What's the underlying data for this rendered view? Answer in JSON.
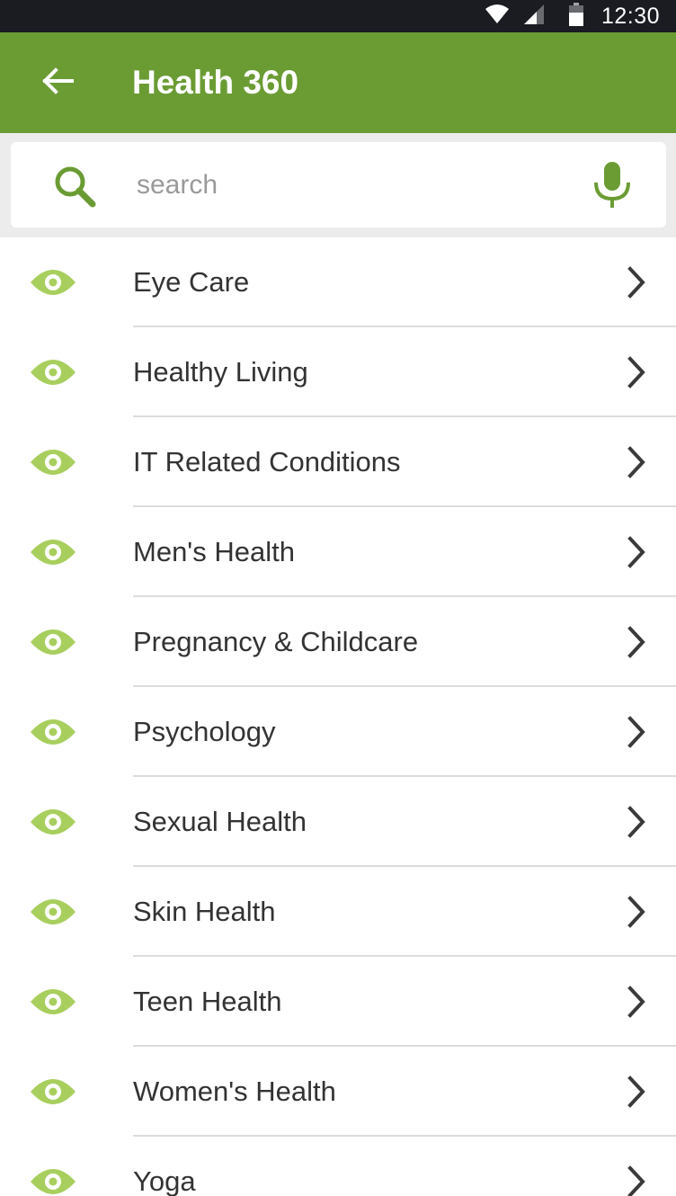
{
  "status_bar": {
    "time": "12:30",
    "icons": [
      "wifi-icon",
      "signal-icon",
      "battery-icon"
    ]
  },
  "app_bar": {
    "title": "Health 360",
    "back_icon": "arrow-left-icon",
    "background_color": "#6b9c34"
  },
  "search": {
    "placeholder": "search",
    "value": "",
    "search_icon": "search-icon",
    "voice_icon": "microphone-icon",
    "icon_color": "#6b9c34"
  },
  "categories": {
    "icon": "eye-icon",
    "icon_color": "#a8cf5e",
    "chevron_icon": "chevron-right-icon",
    "items": [
      {
        "label": "Eye Care"
      },
      {
        "label": "Healthy Living"
      },
      {
        "label": "IT Related Conditions"
      },
      {
        "label": "Men's Health"
      },
      {
        "label": "Pregnancy & Childcare"
      },
      {
        "label": "Psychology"
      },
      {
        "label": "Sexual Health"
      },
      {
        "label": "Skin Health"
      },
      {
        "label": "Teen Health"
      },
      {
        "label": "Women's Health"
      },
      {
        "label": "Yoga"
      }
    ]
  }
}
